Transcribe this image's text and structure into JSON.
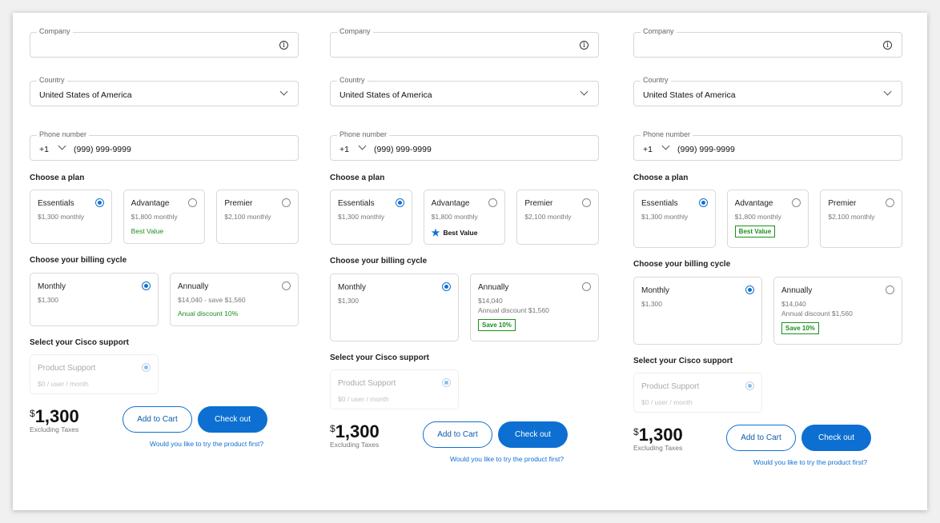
{
  "columns": [
    {
      "company_label": "Company",
      "country_label": "Country",
      "country_value": "United States of America",
      "phone_label": "Phone number",
      "phone_code": "+1",
      "phone_value": "(999) 999-9999",
      "plan_heading": "Choose a plan",
      "plans": [
        {
          "name": "Essentials",
          "price": "$1,300 monthly",
          "selected": true
        },
        {
          "name": "Advantage",
          "price": "$1,800 monthly",
          "tag": "Best Value",
          "selected": false
        },
        {
          "name": "Premier",
          "price": "$2,100 monthly",
          "selected": false
        }
      ],
      "tag_style": "text",
      "billing_heading": "Choose your billing cycle",
      "billing": [
        {
          "name": "Monthly",
          "lines": [
            "$1,300"
          ],
          "selected": true
        },
        {
          "name": "Annually",
          "lines": [
            "$14,040 - save $1,560"
          ],
          "tag": "Anual discount 10%",
          "selected": false
        }
      ],
      "billing_tag_style": "text",
      "support_heading": "Select your Cisco support",
      "support_name": "Product Support",
      "support_price": "$0 / user / month",
      "price_currency": "$",
      "price_value": "1,300",
      "price_note": "Excluding Taxes",
      "add_to_cart": "Add to Cart",
      "checkout": "Check out",
      "trial_link": "Would you like to try the product first?"
    },
    {
      "company_label": "Company",
      "country_label": "Country",
      "country_value": "United States of America",
      "phone_label": "Phone number",
      "phone_code": "+1",
      "phone_value": "(999) 999-9999",
      "plan_heading": "Choose a plan",
      "plans": [
        {
          "name": "Essentials",
          "price": "$1,300 monthly",
          "selected": true
        },
        {
          "name": "Advantage",
          "price": "$1,800 monthly",
          "tag": "Best Value",
          "selected": false
        },
        {
          "name": "Premier",
          "price": "$2,100 monthly",
          "selected": false
        }
      ],
      "tag_style": "star",
      "billing_heading": "Choose your billing cycle",
      "billing": [
        {
          "name": "Monthly",
          "lines": [
            "$1,300"
          ],
          "selected": true
        },
        {
          "name": "Annually",
          "lines": [
            "$14,040",
            "Annual discount $1,560"
          ],
          "tag": "Save 10%",
          "selected": false
        }
      ],
      "billing_tag_style": "badge",
      "support_heading": "Select your Cisco support",
      "support_name": "Product Support",
      "support_price": "$0 / user / month",
      "price_currency": "$",
      "price_value": "1,300",
      "price_note": "Excluding Taxes",
      "add_to_cart": "Add to Cart",
      "checkout": "Check out",
      "trial_link": "Would you like to try the product first?"
    },
    {
      "company_label": "Company",
      "country_label": "Country",
      "country_value": "United States of America",
      "phone_label": "Phone number",
      "phone_code": "+1",
      "phone_value": "(999) 999-9999",
      "plan_heading": "Choose a plan",
      "plans": [
        {
          "name": "Essentials",
          "price": "$1,300 monthly",
          "selected": true
        },
        {
          "name": "Advantage",
          "price": "$1,800 monthly",
          "tag": "Best Value",
          "selected": false
        },
        {
          "name": "Premier",
          "price": "$2,100 monthly",
          "selected": false
        }
      ],
      "tag_style": "badge",
      "billing_heading": "Choose your billing cycle",
      "billing": [
        {
          "name": "Monthly",
          "lines": [
            "$1,300"
          ],
          "selected": true
        },
        {
          "name": "Annually",
          "lines": [
            "$14,040",
            "Annual discount $1,560"
          ],
          "tag": "Save 10%",
          "selected": false
        }
      ],
      "billing_tag_style": "badge",
      "support_heading": "Select your Cisco support",
      "support_name": "Product Support",
      "support_price": "$0 / user / month",
      "price_currency": "$",
      "price_value": "1,300",
      "price_note": "Excluding Taxes",
      "add_to_cart": "Add to Cart",
      "checkout": "Check out",
      "trial_link": "Would you like to try the product first?"
    }
  ],
  "colors": {
    "primary": "#0d6fd1",
    "success": "#1d8f1d"
  }
}
